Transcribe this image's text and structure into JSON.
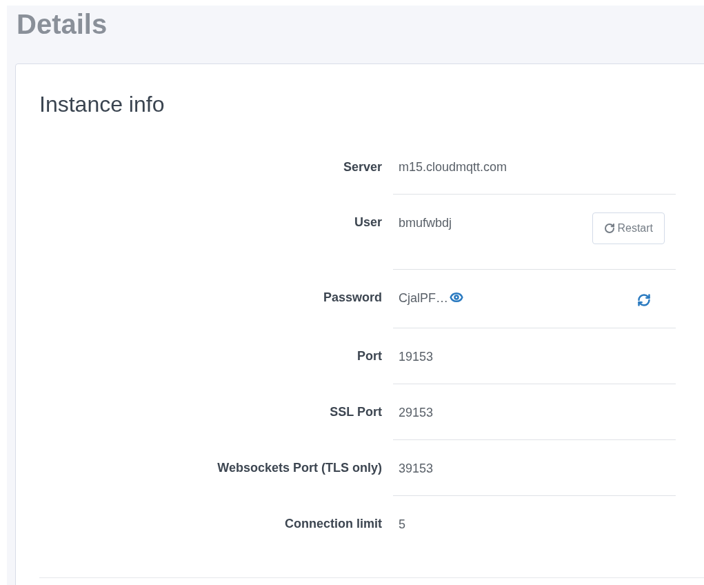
{
  "page_title": "Details",
  "card": {
    "title": "Instance info",
    "fields": [
      {
        "kind": "plain",
        "label": "Server",
        "value": "m15.cloudmqtt.com"
      },
      {
        "kind": "action",
        "label": "User",
        "value": "bmufwbdj",
        "button": "Restart"
      },
      {
        "kind": "secret",
        "label": "Password",
        "value": "CjalPF…"
      },
      {
        "kind": "plain",
        "label": "Port",
        "value": "19153"
      },
      {
        "kind": "plain",
        "label": "SSL Port",
        "value": "29153"
      },
      {
        "kind": "plain",
        "label": "Websockets Port (TLS only)",
        "value": "39153"
      },
      {
        "kind": "plain",
        "label": "Connection limit",
        "value": "5"
      }
    ]
  }
}
